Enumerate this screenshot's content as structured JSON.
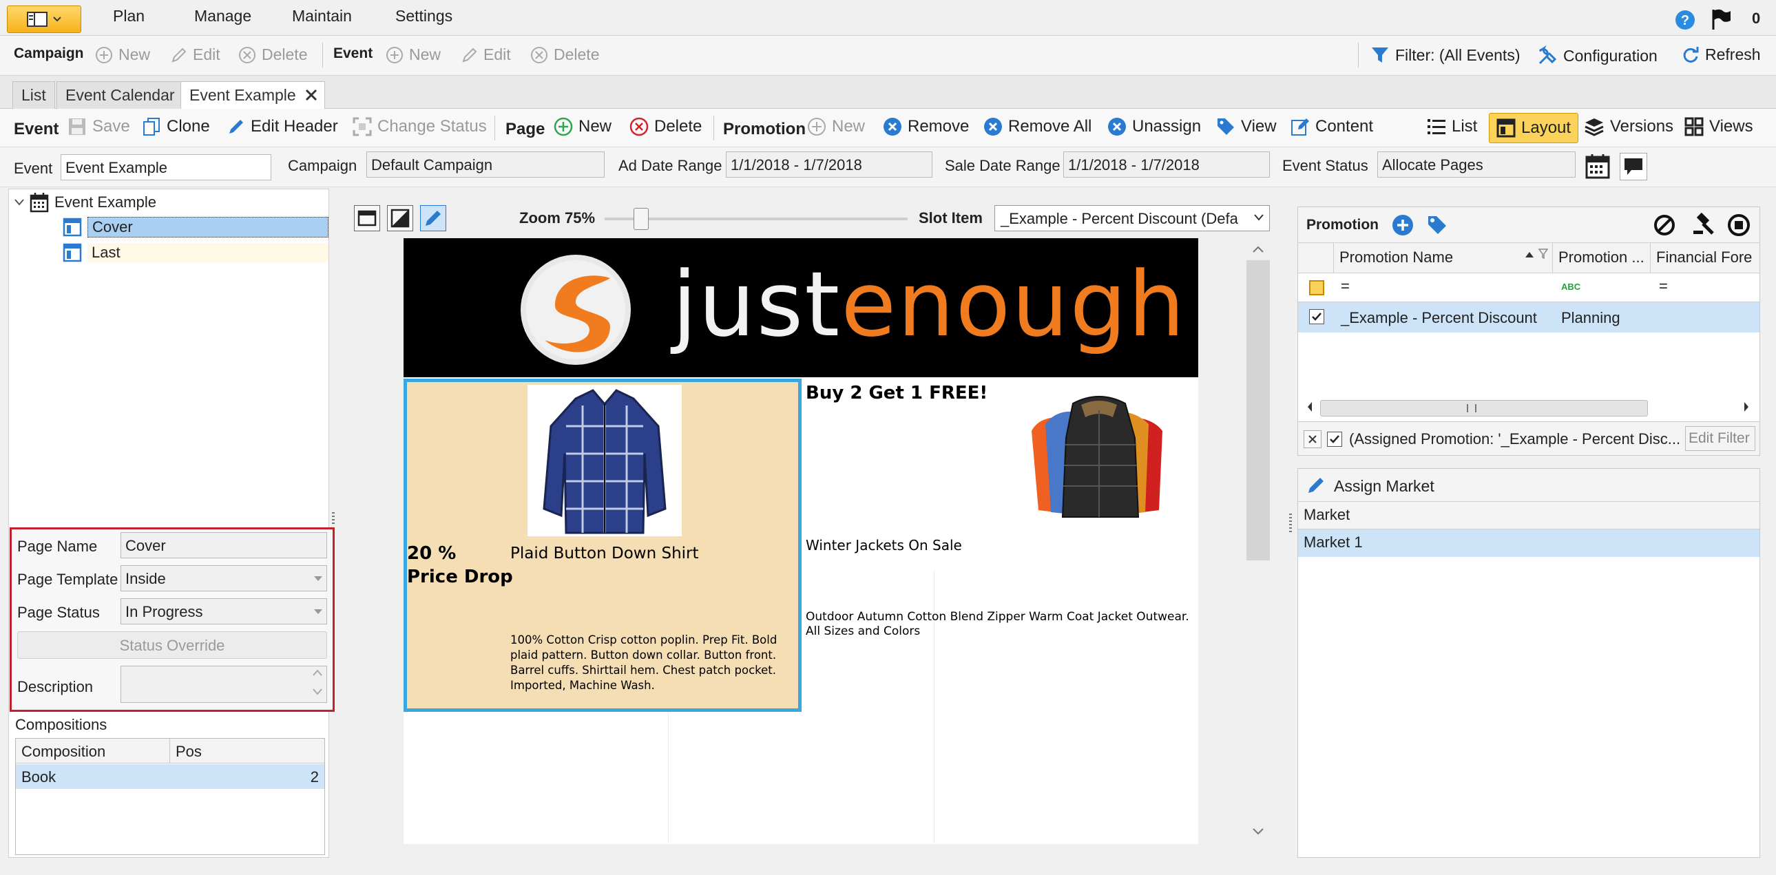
{
  "menu": {
    "items": [
      "Plan",
      "Manage",
      "Maintain",
      "Settings"
    ],
    "flag_count": "0"
  },
  "toolbar": {
    "campaign_label": "Campaign",
    "event_label": "Event",
    "new": "New",
    "edit": "Edit",
    "delete": "Delete",
    "filter": "Filter: (All Events)",
    "configuration": "Configuration",
    "refresh": "Refresh"
  },
  "tabs": [
    {
      "label": "List"
    },
    {
      "label": "Event Calendar"
    },
    {
      "label": "Event Example"
    }
  ],
  "event_toolbar": {
    "event_label": "Event",
    "save": "Save",
    "clone": "Clone",
    "edit_header": "Edit Header",
    "change_status": "Change Status",
    "page_label": "Page",
    "new": "New",
    "delete": "Delete",
    "promotion_label": "Promotion",
    "promo_new": "New",
    "remove": "Remove",
    "remove_all": "Remove All",
    "unassign": "Unassign",
    "view": "View",
    "content": "Content",
    "list": "List",
    "layout": "Layout",
    "versions": "Versions",
    "views": "Views"
  },
  "fields": {
    "event_label": "Event",
    "event_value": "Event Example",
    "campaign_label": "Campaign",
    "campaign_value": "Default Campaign",
    "ad_date_label": "Ad Date Range",
    "ad_date_value": "1/1/2018 - 1/7/2018",
    "sale_date_label": "Sale Date Range",
    "sale_date_value": "1/1/2018 - 1/7/2018",
    "event_status_label": "Event Status",
    "event_status_value": "Allocate Pages"
  },
  "tree": {
    "root": "Event Example",
    "children": [
      "Cover",
      "Last"
    ]
  },
  "page_props": {
    "page_name_label": "Page Name",
    "page_name_value": "Cover",
    "page_template_label": "Page Template",
    "page_template_value": "Inside",
    "page_status_label": "Page Status",
    "page_status_value": "In Progress",
    "status_override": "Status Override",
    "description_label": "Description"
  },
  "compositions": {
    "title": "Compositions",
    "columns": [
      "Composition",
      "Pos"
    ],
    "rows": [
      {
        "composition": "Book",
        "pos": "2"
      }
    ]
  },
  "canvas": {
    "zoom_label": "Zoom 75%",
    "zoom_fraction": 0.1,
    "slot_label": "Slot Item",
    "slot_value": "_Example - Percent Discount (Defa",
    "logo_part1": "just",
    "logo_part2": "enough",
    "slot1": {
      "price": "20 %\nPrice Drop",
      "title": "Plaid Button Down Shirt",
      "desc": "100% Cotton Crisp cotton poplin. Prep Fit. Bold plaid pattern. Button down collar. Button front. Barrel cuffs. Shirttail hem. Chest patch pocket. Imported, Machine Wash."
    },
    "slot2": {
      "headline": "Buy 2 Get 1 FREE!",
      "title": "Winter Jackets On Sale",
      "desc": "Outdoor Autumn Cotton Blend Zipper Warm Coat Jacket Outwear. All Sizes and Colors"
    }
  },
  "promotion": {
    "title": "Promotion",
    "columns": [
      "Promotion Name",
      "Promotion ...",
      "Financial Fore"
    ],
    "filter_row": [
      "=",
      "ABC",
      "="
    ],
    "rows": [
      {
        "name": "_Example - Percent Discount",
        "status": "Planning"
      }
    ],
    "filter_text": "(Assigned Promotion: '_Example - Percent Disc...",
    "edit_filter": "Edit Filter"
  },
  "assign_market": {
    "title": "Assign Market",
    "column": "Market",
    "rows": [
      "Market 1"
    ]
  },
  "colors": {
    "accent_orange": "#f7b21b",
    "selection_blue": "#cde3f8",
    "highlight_red": "#c0212b",
    "slot_border": "#3aa8e0",
    "logo_orange": "#f07c1f"
  }
}
